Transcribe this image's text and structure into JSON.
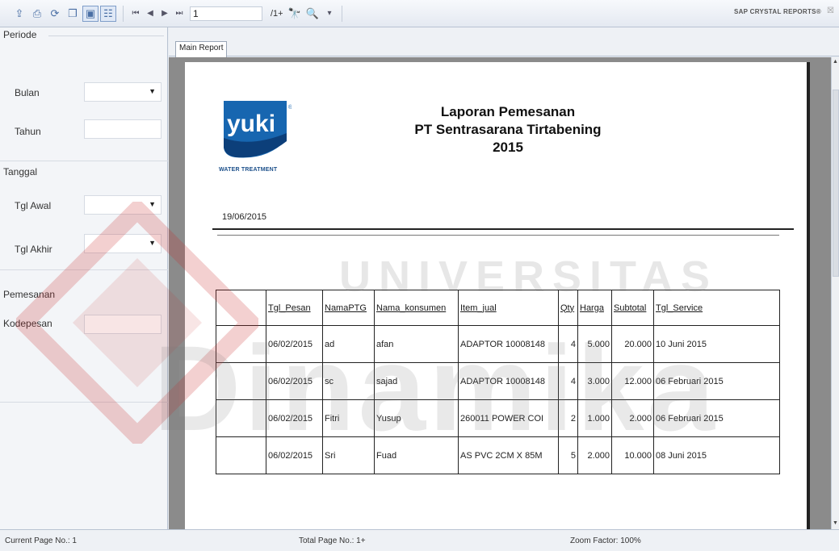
{
  "toolbar": {
    "page_number": "1",
    "page_of": "/1+",
    "brand": "SAP CRYSTAL REPORTS®"
  },
  "left_panel": {
    "periode": "Periode",
    "bulan": "Bulan",
    "tahun": "Tahun",
    "tanggal": "Tanggal",
    "tgl_awal": "Tgl Awal",
    "tgl_akhir": "Tgl Akhir",
    "pemesanan": "Pemesanan",
    "kodepesan": "Kodepesan"
  },
  "tabs": {
    "main_report": "Main Report"
  },
  "report": {
    "logo_text": "yuki",
    "logo_sub": "WATER TREATMENT",
    "title": "Laporan Pemesanan",
    "company": "PT Sentrasarana Tirtabening",
    "year": "2015",
    "date": "19/06/2015",
    "columns": [
      "Tgl_Pesan",
      "NamaPTG",
      "Nama_konsumen",
      "Item_jual",
      "Qty",
      "Harga",
      "Subtotal",
      "Tgl_Service"
    ],
    "rows": [
      [
        "06/02/2015",
        "ad",
        "afan",
        "ADAPTOR 10008148",
        "4",
        "5.000",
        "20.000",
        "10 Juni 2015"
      ],
      [
        "06/02/2015",
        "sc",
        "sajad",
        "ADAPTOR 10008148",
        "4",
        "3.000",
        "12.000",
        "06 Februari 2015"
      ],
      [
        "06/02/2015",
        "Fitri",
        "Yusup",
        "260011 POWER COI",
        "2",
        "1.000",
        "2.000",
        "06 Februari 2015"
      ],
      [
        "06/02/2015",
        "Sri",
        "Fuad",
        "AS PVC 2CM X 85M",
        "5",
        "2.000",
        "10.000",
        "08 Juni 2015"
      ]
    ]
  },
  "status": {
    "current_page": "Current Page No.: 1",
    "total_page": "Total Page No.: 1+",
    "zoom": "Zoom Factor: 100%"
  },
  "watermark": {
    "line1": "UNIVERSITAS",
    "line2": "Dinamika"
  }
}
